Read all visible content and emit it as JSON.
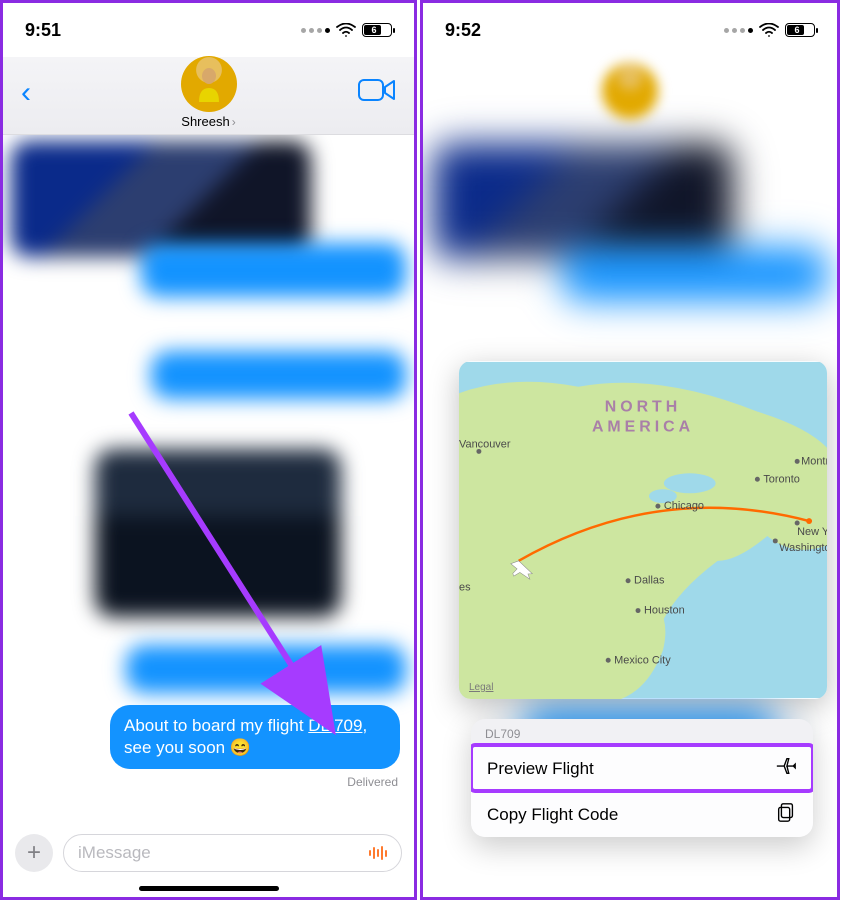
{
  "left": {
    "status": {
      "time": "9:51",
      "battery": "6"
    },
    "nav": {
      "contact_name": "Shreesh"
    },
    "message": {
      "prefix": "About to board my flight ",
      "flight_code": "DL 709",
      "suffix": ", see you soon 😄"
    },
    "delivered_label": "Delivered",
    "compose_placeholder": "iMessage"
  },
  "right": {
    "status": {
      "time": "9:52",
      "battery": "6"
    },
    "map": {
      "continent_label_1": "NORTH",
      "continent_label_2": "AMERICA",
      "legal_label": "Legal",
      "cities": {
        "vancouver": "Vancouver",
        "chicago": "Chicago",
        "toronto": "Toronto",
        "montreal": "Montr",
        "newyork": "New Yo",
        "washington": "Washingto",
        "dallas": "Dallas",
        "houston": "Houston",
        "mexico": "Mexico City",
        "es": "es"
      }
    },
    "menu": {
      "header": "DL709",
      "preview": "Preview Flight",
      "copy": "Copy Flight Code"
    }
  }
}
